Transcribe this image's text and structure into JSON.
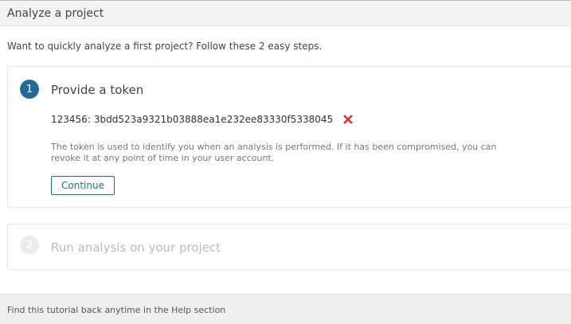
{
  "header": {
    "title": "Analyze a project"
  },
  "intro": {
    "text": "Want to quickly analyze a first project? Follow these 2 easy steps."
  },
  "steps": [
    {
      "number": "1",
      "title": "Provide a token",
      "state": "active",
      "token": {
        "name": "123456",
        "separator": ":",
        "value": "3bdd523a9321b03888ea1e232ee83330f5338045"
      },
      "help_text": "The token is used to identify you when an analysis is performed. If it has been compromised, you can revoke it at any point of time in your user account.",
      "continue_label": "Continue"
    },
    {
      "number": "2",
      "title": "Run analysis on your project",
      "state": "disabled"
    }
  ],
  "footer": {
    "text": "Find this tutorial back anytime in the Help section"
  },
  "colors": {
    "accent": "#236a97",
    "revoke": "#d4333f",
    "disabled_text": "#bbbbbb"
  },
  "icons": {
    "revoke": "close-icon"
  }
}
